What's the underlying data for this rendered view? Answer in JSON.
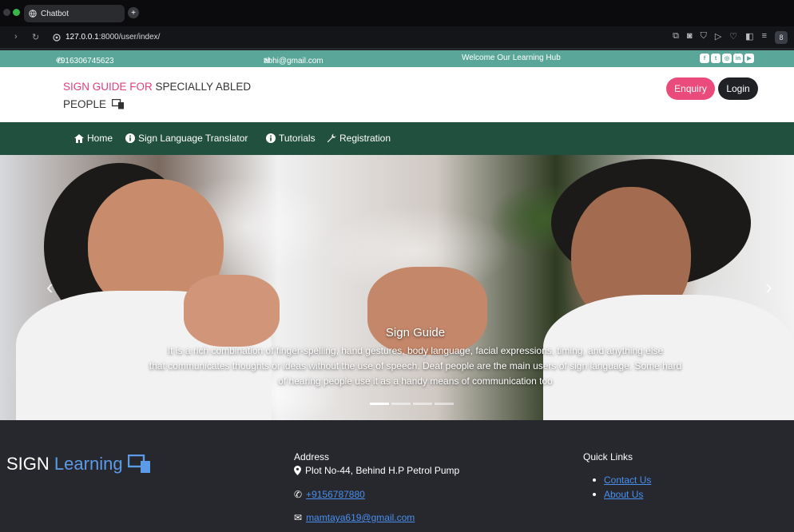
{
  "browser": {
    "tab_title": "Chatbot",
    "new_tab_icon": "plus-icon",
    "url_host": "127.0.0.1",
    "url_rest": ":8000/user/index/",
    "profile_initial": "8"
  },
  "topbar": {
    "phone": "+916306745623",
    "email": "abhi@gmail.com",
    "welcome": "Welcome Our Learning Hub",
    "social_icons": [
      "facebook-icon",
      "twitter-icon",
      "instagram-icon",
      "linkedin-icon",
      "youtube-icon"
    ],
    "color": "#5aa79a"
  },
  "header": {
    "brand_pink": "SIGN GUIDE FOR",
    "brand_rest": " SPECIALLY ABLED PEOPLE",
    "enquiry_label": "Enquiry",
    "login_label": "Login",
    "brand_color": "#e23f7b"
  },
  "nav": {
    "items": [
      {
        "label": "Home",
        "icon": "home-icon"
      },
      {
        "label": "Sign Language Translator",
        "icon": "info-icon"
      },
      {
        "label": "Tutorials",
        "icon": "info-icon"
      },
      {
        "label": "Registration",
        "icon": "wrench-icon"
      }
    ],
    "color": "#21503e"
  },
  "hero": {
    "title": "Sign Guide",
    "line1": "It is a rich combination of finger-spelling, hand gestures, body language, facial expressions, timing, and anything else",
    "line2": "that communicates thoughts or ideas without the use of speech. Deaf people are the main users of sign language. Some hard",
    "line3": "of hearing people use it as a handy means of communication too",
    "slides": 4,
    "active_slide": 1
  },
  "footer": {
    "logo_white": "SIGN",
    "logo_blue": "Learning",
    "address_heading": "Address",
    "address": "Plot No-44, Behind H.P Petrol Pump",
    "phone": "+9156787880",
    "email": "mamtaya619@gmail.com",
    "quick_links_heading": "Quick Links",
    "links": [
      "Contact Us",
      "About Us"
    ],
    "link_color": "#4a8ff0"
  }
}
